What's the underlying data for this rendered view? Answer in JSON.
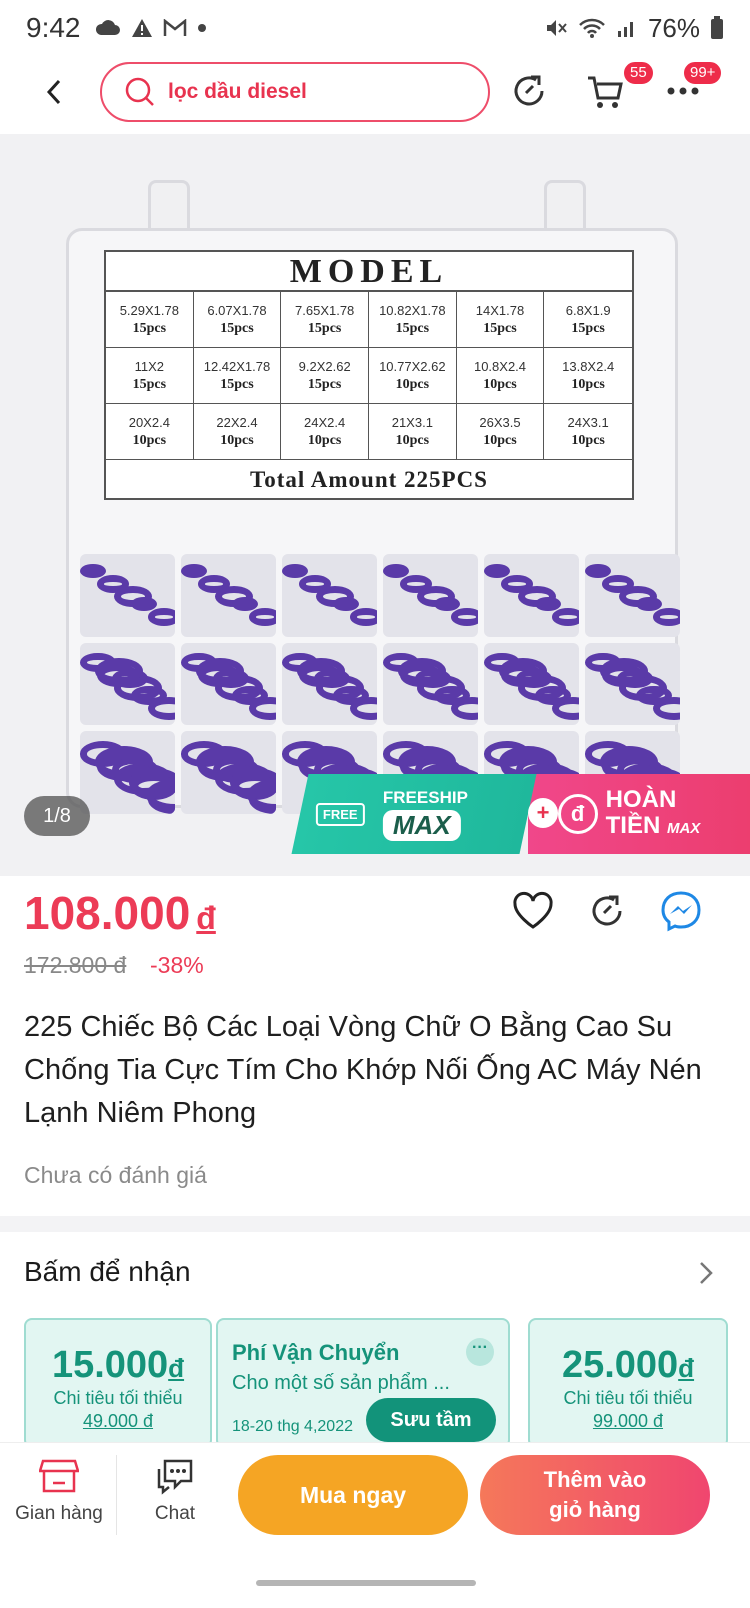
{
  "status_bar": {
    "time": "9:42",
    "battery": "76%"
  },
  "header": {
    "search_query": "lọc dầu diesel",
    "cart_count": "55",
    "more_count": "99+"
  },
  "gallery": {
    "model_heading": "MODEL",
    "sizes": [
      {
        "size": "5.29X1.78",
        "pcs": "15pcs"
      },
      {
        "size": "6.07X1.78",
        "pcs": "15pcs"
      },
      {
        "size": "7.65X1.78",
        "pcs": "15pcs"
      },
      {
        "size": "10.82X1.78",
        "pcs": "15pcs"
      },
      {
        "size": "14X1.78",
        "pcs": "15pcs"
      },
      {
        "size": "6.8X1.9",
        "pcs": "15pcs"
      },
      {
        "size": "11X2",
        "pcs": "15pcs"
      },
      {
        "size": "12.42X1.78",
        "pcs": "15pcs"
      },
      {
        "size": "9.2X2.62",
        "pcs": "15pcs"
      },
      {
        "size": "10.77X2.62",
        "pcs": "10pcs"
      },
      {
        "size": "10.8X2.4",
        "pcs": "10pcs"
      },
      {
        "size": "13.8X2.4",
        "pcs": "10pcs"
      },
      {
        "size": "20X2.4",
        "pcs": "10pcs"
      },
      {
        "size": "22X2.4",
        "pcs": "10pcs"
      },
      {
        "size": "24X2.4",
        "pcs": "10pcs"
      },
      {
        "size": "21X3.1",
        "pcs": "10pcs"
      },
      {
        "size": "26X3.5",
        "pcs": "10pcs"
      },
      {
        "size": "24X3.1",
        "pcs": "10pcs"
      }
    ],
    "total_label": "Total Amount 225PCS",
    "counter": "1/8",
    "promo": {
      "free_tag": "FREE",
      "freeship_label": "FREESHIP",
      "freeship_max": "MAX",
      "refund_symbol": "đ",
      "refund_line1": "HOÀN",
      "refund_line2": "TIỀN",
      "refund_max": "MAX"
    }
  },
  "product": {
    "price": "108.000",
    "currency": "đ",
    "old_price": "172.800 đ",
    "discount": "-38%",
    "title": "225 Chiếc Bộ Các Loại Vòng Chữ O Bằng Cao Su Chống Tia Cực Tím Cho Khớp Nối Ống AC Máy Nén Lạnh Niêm Phong",
    "rating_text": "Chưa có đánh giá"
  },
  "vouchers": {
    "heading": "Bấm để nhận",
    "items": [
      {
        "amount": "15.000",
        "currency": "đ",
        "min_label": "Chi tiêu tối thiểu",
        "min_value": "49.000 đ"
      },
      {
        "title": "Phí Vận Chuyển",
        "subtitle": "Cho một số sản phẩm ...",
        "date": "18-20 thg 4,2022",
        "button": "Sưu tầm"
      },
      {
        "amount": "25.000",
        "currency": "đ",
        "min_label": "Chi tiêu tối thiểu",
        "min_value": "99.000 đ"
      }
    ]
  },
  "bottom_bar": {
    "shop_label": "Gian hàng",
    "chat_label": "Chat",
    "buy_now": "Mua ngay",
    "add_to_cart": "Thêm vào\ngiỏ hàng"
  },
  "colors": {
    "accent": "#ec3b56",
    "buy_now": "#f5a524",
    "voucher": "#15937a"
  }
}
